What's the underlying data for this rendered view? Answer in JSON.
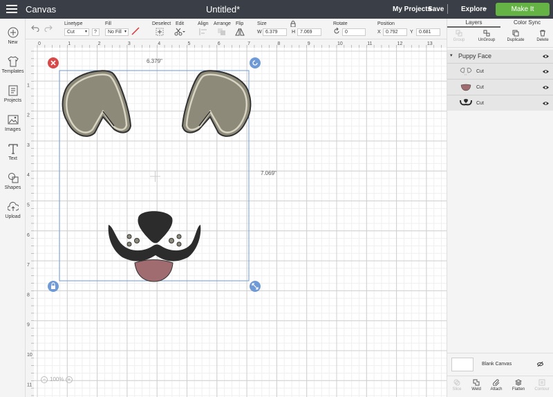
{
  "topbar": {
    "app_name": "Canvas",
    "doc_title": "Untitled*",
    "my_projects": "My Projects",
    "save": "Save",
    "separator": "|",
    "explore": "Explore",
    "make_it": "Make It"
  },
  "toolbar": {
    "linetype_label": "Linetype",
    "linetype_value": "Cut",
    "linetype_help": "?",
    "fill_label": "Fill",
    "fill_value": "No Fill",
    "deselect_label": "Deselect",
    "edit_label": "Edit",
    "align_label": "Align",
    "arrange_label": "Arrange",
    "flip_label": "Flip",
    "size_label": "Size",
    "w_label": "W",
    "w_value": "6.379",
    "h_label": "H",
    "h_value": "7.069",
    "rotate_label": "Rotate",
    "rotate_value": "0",
    "position_label": "Position",
    "x_label": "X",
    "x_value": "0.792",
    "y_label": "Y",
    "y_value": "0.681"
  },
  "leftbar": [
    {
      "label": "New",
      "icon": "plus-icon"
    },
    {
      "label": "Templates",
      "icon": "shirt-icon"
    },
    {
      "label": "Projects",
      "icon": "projects-icon"
    },
    {
      "label": "Images",
      "icon": "image-icon"
    },
    {
      "label": "Text",
      "icon": "text-icon"
    },
    {
      "label": "Shapes",
      "icon": "shapes-icon"
    },
    {
      "label": "Upload",
      "icon": "upload-icon"
    }
  ],
  "canvas": {
    "ruler_top": [
      "0",
      "1",
      "2",
      "3",
      "4",
      "5",
      "6",
      "7",
      "8",
      "9",
      "10",
      "11",
      "12",
      "13"
    ],
    "ruler_left": [
      "1",
      "2",
      "3",
      "4",
      "5",
      "6",
      "7",
      "8",
      "9",
      "10",
      "11"
    ],
    "width_dim": "6.379\"",
    "height_dim": "7.069\"",
    "zoom": "100%",
    "zoom_minus": "−",
    "zoom_plus": "+"
  },
  "rpanel": {
    "tab_layers": "Layers",
    "tab_colorsync": "Color Sync",
    "tool_group": "Group",
    "tool_ungroup": "UnGroup",
    "tool_duplicate": "Duplicate",
    "tool_delete": "Delete",
    "group_name": "Puppy Face",
    "layers": [
      {
        "label": "Cut",
        "thumb": "ears-thumb"
      },
      {
        "label": "Cut",
        "thumb": "tongue-thumb"
      },
      {
        "label": "Cut",
        "thumb": "nose-thumb"
      }
    ],
    "blank_canvas": "Blank Canvas",
    "bottom_tools": [
      "Slice",
      "Weld",
      "Attach",
      "Flatten",
      "Contour"
    ]
  },
  "colors": {
    "topbar": "#3a3f47",
    "make_it": "#65b345",
    "selection": "#6f9ad6",
    "delete_badge": "#d84a4a",
    "ear_fill": "#8d8a7a",
    "nose": "#2c2c2c",
    "tongue": "#a06c6f"
  }
}
